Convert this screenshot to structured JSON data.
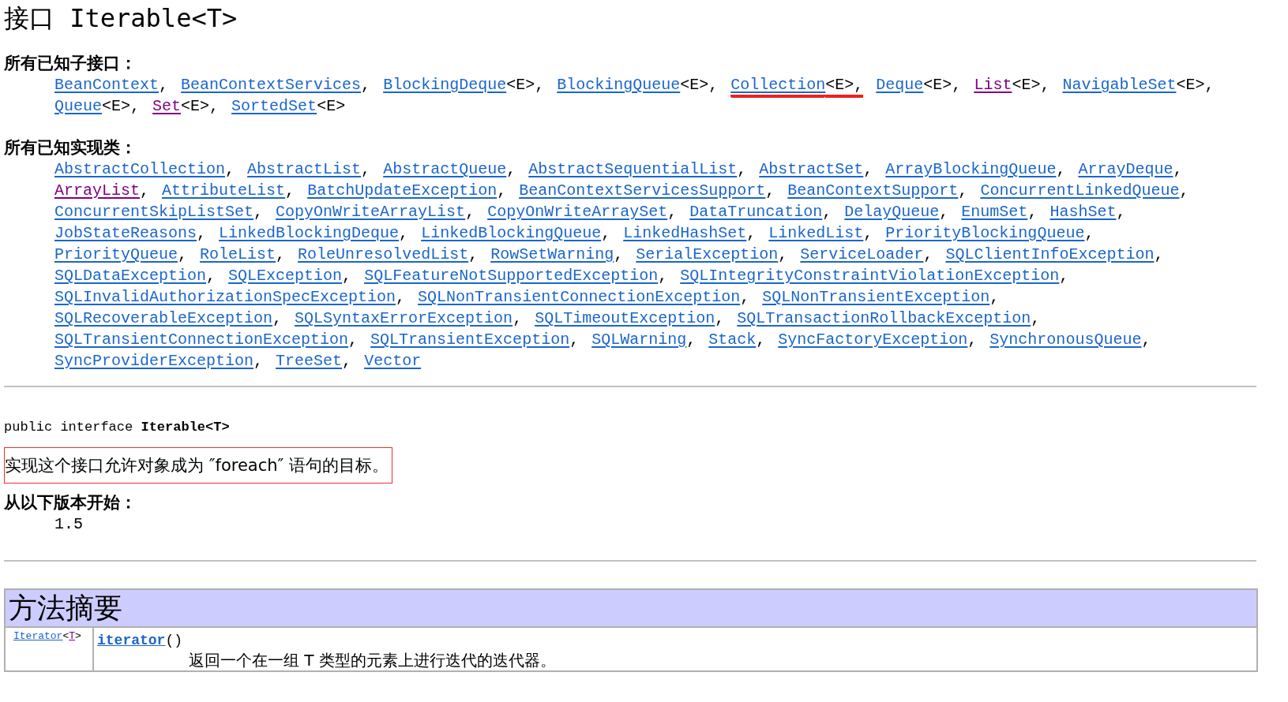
{
  "title": "接口 Iterable<T>",
  "subinterfaces": {
    "heading": "所有已知子接口：",
    "items": [
      {
        "name": "BeanContext",
        "suffix": ",",
        "visited": false,
        "highlighted": false
      },
      {
        "name": "BeanContextServices",
        "suffix": ",",
        "visited": false,
        "highlighted": false
      },
      {
        "name": "BlockingDeque",
        "suffix": "<E>,",
        "visited": false,
        "highlighted": false
      },
      {
        "name": "BlockingQueue",
        "suffix": "<E>,",
        "visited": false,
        "highlighted": false
      },
      {
        "name": "Collection",
        "suffix": "<E>,",
        "visited": false,
        "highlighted": true
      },
      {
        "name": "Deque",
        "suffix": "<E>,",
        "visited": false,
        "highlighted": false
      },
      {
        "name": "List",
        "suffix": "<E>,",
        "visited": true,
        "highlighted": false
      },
      {
        "name": "NavigableSet",
        "suffix": "<E>,",
        "visited": false,
        "highlighted": false
      },
      {
        "name": "Queue",
        "suffix": "<E>,",
        "visited": false,
        "highlighted": false
      },
      {
        "name": "Set",
        "suffix": "<E>,",
        "visited": true,
        "highlighted": false
      },
      {
        "name": "SortedSet",
        "suffix": "<E>",
        "visited": false,
        "highlighted": false
      }
    ]
  },
  "implementing_classes": {
    "heading": "所有已知实现类：",
    "items": [
      {
        "name": "AbstractCollection",
        "suffix": ",",
        "visited": false,
        "highlighted": false
      },
      {
        "name": "AbstractList",
        "suffix": ",",
        "visited": false,
        "highlighted": false
      },
      {
        "name": "AbstractQueue",
        "suffix": ",",
        "visited": false,
        "highlighted": false
      },
      {
        "name": "AbstractSequentialList",
        "suffix": ",",
        "visited": false,
        "highlighted": false
      },
      {
        "name": "AbstractSet",
        "suffix": ",",
        "visited": false,
        "highlighted": false
      },
      {
        "name": "ArrayBlockingQueue",
        "suffix": ",",
        "visited": false,
        "highlighted": false
      },
      {
        "name": "ArrayDeque",
        "suffix": ",",
        "visited": false,
        "highlighted": false
      },
      {
        "name": "ArrayList",
        "suffix": ",",
        "visited": true,
        "highlighted": false
      },
      {
        "name": "AttributeList",
        "suffix": ",",
        "visited": false,
        "highlighted": false
      },
      {
        "name": "BatchUpdateException",
        "suffix": ",",
        "visited": false,
        "highlighted": false
      },
      {
        "name": "BeanContextServicesSupport",
        "suffix": ",",
        "visited": false,
        "highlighted": false
      },
      {
        "name": "BeanContextSupport",
        "suffix": ",",
        "visited": false,
        "highlighted": false
      },
      {
        "name": "ConcurrentLinkedQueue",
        "suffix": ",",
        "visited": false,
        "highlighted": false
      },
      {
        "name": "ConcurrentSkipListSet",
        "suffix": ",",
        "visited": false,
        "highlighted": false
      },
      {
        "name": "CopyOnWriteArrayList",
        "suffix": ",",
        "visited": false,
        "highlighted": false
      },
      {
        "name": "CopyOnWriteArraySet",
        "suffix": ",",
        "visited": false,
        "highlighted": false
      },
      {
        "name": "DataTruncation",
        "suffix": ",",
        "visited": false,
        "highlighted": false
      },
      {
        "name": "DelayQueue",
        "suffix": ",",
        "visited": false,
        "highlighted": false
      },
      {
        "name": "EnumSet",
        "suffix": ",",
        "visited": false,
        "highlighted": false
      },
      {
        "name": "HashSet",
        "suffix": ",",
        "visited": false,
        "highlighted": false
      },
      {
        "name": "JobStateReasons",
        "suffix": ",",
        "visited": false,
        "highlighted": false
      },
      {
        "name": "LinkedBlockingDeque",
        "suffix": ",",
        "visited": false,
        "highlighted": false
      },
      {
        "name": "LinkedBlockingQueue",
        "suffix": ",",
        "visited": false,
        "highlighted": false
      },
      {
        "name": "LinkedHashSet",
        "suffix": ",",
        "visited": false,
        "highlighted": false
      },
      {
        "name": "LinkedList",
        "suffix": ",",
        "visited": false,
        "highlighted": false
      },
      {
        "name": "PriorityBlockingQueue",
        "suffix": ",",
        "visited": false,
        "highlighted": false
      },
      {
        "name": "PriorityQueue",
        "suffix": ",",
        "visited": false,
        "highlighted": false
      },
      {
        "name": "RoleList",
        "suffix": ",",
        "visited": false,
        "highlighted": false
      },
      {
        "name": "RoleUnresolvedList",
        "suffix": ",",
        "visited": false,
        "highlighted": false
      },
      {
        "name": "RowSetWarning",
        "suffix": ",",
        "visited": false,
        "highlighted": false
      },
      {
        "name": "SerialException",
        "suffix": ",",
        "visited": false,
        "highlighted": false
      },
      {
        "name": "ServiceLoader",
        "suffix": ",",
        "visited": false,
        "highlighted": false
      },
      {
        "name": "SQLClientInfoException",
        "suffix": ",",
        "visited": false,
        "highlighted": false
      },
      {
        "name": "SQLDataException",
        "suffix": ",",
        "visited": false,
        "highlighted": false
      },
      {
        "name": "SQLException",
        "suffix": ",",
        "visited": false,
        "highlighted": false
      },
      {
        "name": "SQLFeatureNotSupportedException",
        "suffix": ",",
        "visited": false,
        "highlighted": false
      },
      {
        "name": "SQLIntegrityConstraintViolationException",
        "suffix": ",",
        "visited": false,
        "highlighted": false
      },
      {
        "name": "SQLInvalidAuthorizationSpecException",
        "suffix": ",",
        "visited": false,
        "highlighted": false
      },
      {
        "name": "SQLNonTransientConnectionException",
        "suffix": ",",
        "visited": false,
        "highlighted": false
      },
      {
        "name": "SQLNonTransientException",
        "suffix": ",",
        "visited": false,
        "highlighted": false
      },
      {
        "name": "SQLRecoverableException",
        "suffix": ",",
        "visited": false,
        "highlighted": false
      },
      {
        "name": "SQLSyntaxErrorException",
        "suffix": ",",
        "visited": false,
        "highlighted": false
      },
      {
        "name": "SQLTimeoutException",
        "suffix": ",",
        "visited": false,
        "highlighted": false
      },
      {
        "name": "SQLTransactionRollbackException",
        "suffix": ",",
        "visited": false,
        "highlighted": false
      },
      {
        "name": "SQLTransientConnectionException",
        "suffix": ",",
        "visited": false,
        "highlighted": false
      },
      {
        "name": "SQLTransientException",
        "suffix": ",",
        "visited": false,
        "highlighted": false
      },
      {
        "name": "SQLWarning",
        "suffix": ",",
        "visited": false,
        "highlighted": false
      },
      {
        "name": "Stack",
        "suffix": ",",
        "visited": false,
        "highlighted": false
      },
      {
        "name": "SyncFactoryException",
        "suffix": ",",
        "visited": false,
        "highlighted": false
      },
      {
        "name": "SynchronousQueue",
        "suffix": ",",
        "visited": false,
        "highlighted": false
      },
      {
        "name": "SyncProviderException",
        "suffix": ",",
        "visited": false,
        "highlighted": false
      },
      {
        "name": "TreeSet",
        "suffix": ",",
        "visited": false,
        "highlighted": false
      },
      {
        "name": "Vector",
        "visited": false,
        "highlighted": false
      }
    ]
  },
  "signature": "public interface **Iterable<T>**",
  "description": {
    "text": "实现这个接口允许对象成为 ″foreach″ 语句的目标。",
    "highlighted": true
  },
  "since": {
    "heading": "从以下版本开始：",
    "value": "1.5"
  },
  "method_summary": {
    "title": "方法摘要",
    "rows": [
      {
        "return_type": {
          "name": "Iterator",
          "visited": false,
          "open": "<",
          "param": "T",
          "param_visited": true,
          "close": ">"
        },
        "method": "iterator",
        "params": "()",
        "description": "返回一个在一组 T 类型的元素上进行迭代的迭代器。"
      }
    ]
  }
}
